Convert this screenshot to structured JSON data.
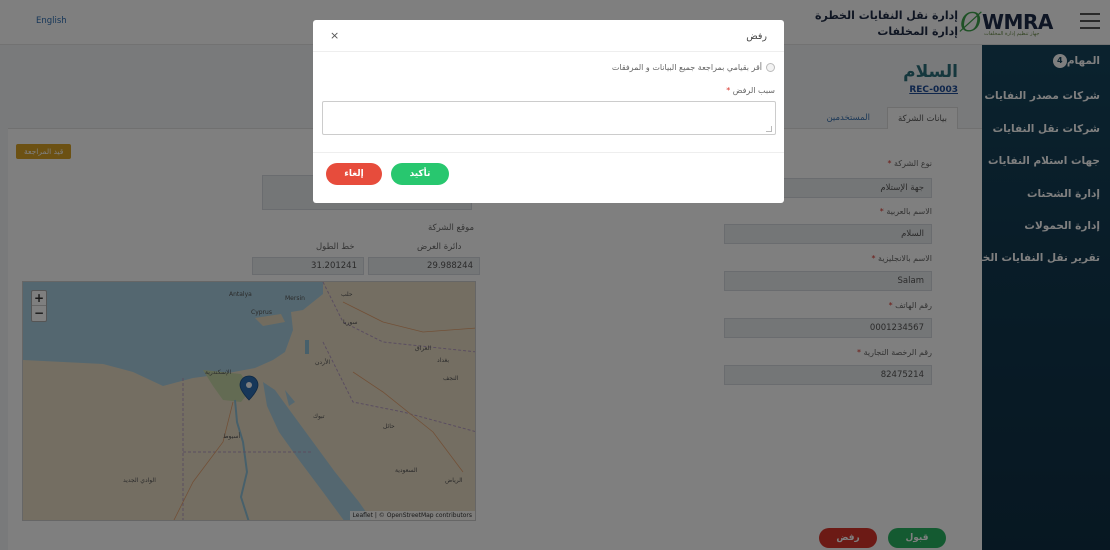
{
  "header": {
    "title_line1": "إدارة نقل النفايات الخطرة",
    "title_line2": "إدارة المخلفات",
    "logo_text": "WMRA",
    "logo_sub": "جهاز تنظيم إدارة المخلفات",
    "language_link": "English"
  },
  "sidebar": {
    "items": [
      {
        "label": "المهام",
        "badge": "4"
      },
      {
        "label": "شركات مصدر النفايات"
      },
      {
        "label": "شركات نقل النفايات"
      },
      {
        "label": "جهات استلام النفايات"
      },
      {
        "label": "إدارة الشحنات"
      },
      {
        "label": "إدارة الحمولات"
      },
      {
        "label": "تقرير نقل النفايات الخطرة"
      }
    ]
  },
  "page": {
    "title": "السلام",
    "code": "REC-0003",
    "tabs": [
      "بيانات الشركة",
      "المستخدمين"
    ],
    "review_badge": "قيد المراجعة",
    "fields": [
      {
        "label": "نوع الشركة",
        "value": "جهة الإستلام"
      },
      {
        "label": "الاسم بالعربية",
        "value": "السلام"
      },
      {
        "label": "الاسم بالانجليزية",
        "value": "Salam"
      },
      {
        "label": "رقم الهاتف",
        "value": "0001234567"
      },
      {
        "label": "رقم الرخصة التجارية",
        "value": "82475214"
      }
    ],
    "location": {
      "label": "موقع الشركة",
      "lat_label": "دائرة العرض",
      "lng_label": "خط الطول",
      "lat_value": "29.988244",
      "lng_value": "31.201241"
    },
    "map": {
      "zoom_in": "+",
      "zoom_out": "−",
      "attribution": "Leaflet | © OpenStreetMap contributors",
      "place_labels": [
        "سوريا",
        "العراق",
        "بغداد",
        "الأردن",
        "السعودية",
        "الرياض",
        "أسيوط",
        "النجف",
        "Antalya",
        "Mersin",
        "حلب",
        "Cyprus",
        "الإسكندرية",
        "الوادي الجديد",
        "تبوك",
        "حائل"
      ]
    },
    "accept_button": "قبول",
    "reject_button": "رفض"
  },
  "modal": {
    "title": "رفض",
    "close": "×",
    "confirm_text": "أقر بقيامي بمراجعة جميع البيانات و المرفقات",
    "reason_label": "سبب الرفض",
    "reason_value": "",
    "confirm_button": "تأكيد",
    "cancel_button": "إلغاء"
  },
  "colors": {
    "sidebar": "#16455d",
    "accept": "#28b463",
    "reject": "#d9342b",
    "review": "#d8a326",
    "link": "#1f4d99"
  }
}
